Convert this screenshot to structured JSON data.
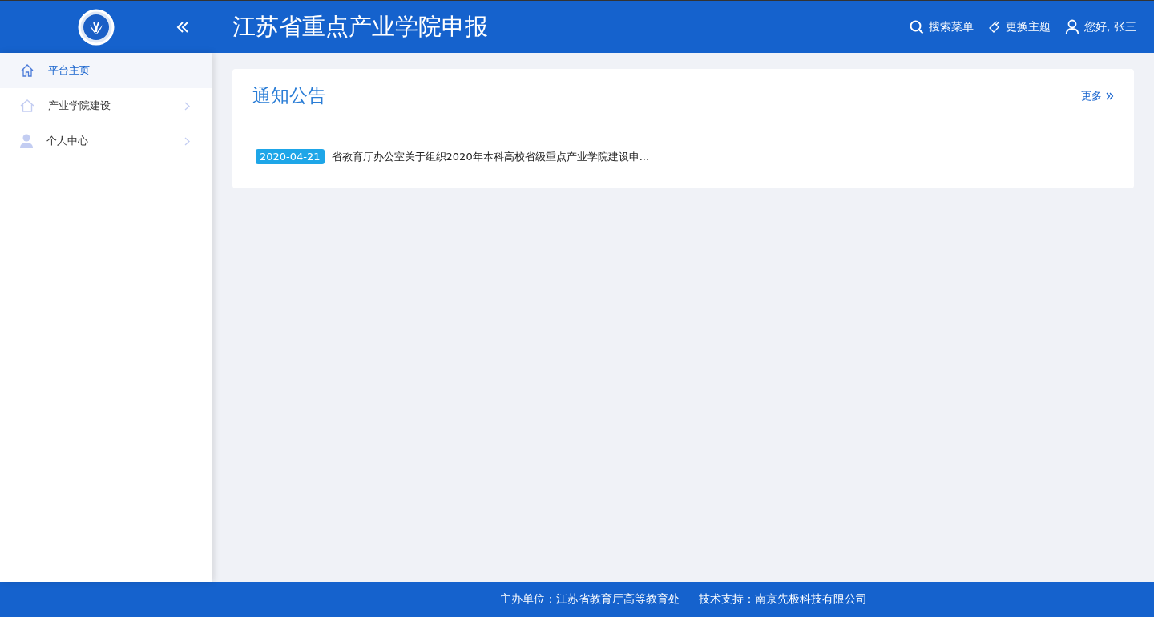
{
  "header": {
    "title": "江苏省重点产业学院申报",
    "actions": [
      {
        "kind": "search",
        "label": "搜索菜单"
      },
      {
        "kind": "theme",
        "label": "更换主题"
      },
      {
        "kind": "user",
        "label": "您好, 张三"
      }
    ]
  },
  "sidebar": {
    "items": [
      {
        "kind": "home",
        "label": "平台主页",
        "selected": true,
        "expandable": false
      },
      {
        "kind": "house",
        "label": "产业学院建设",
        "selected": false,
        "expandable": true
      },
      {
        "kind": "user",
        "label": "个人中心",
        "selected": false,
        "expandable": true
      }
    ]
  },
  "notice": {
    "title": "通知公告",
    "more": "更多",
    "items": [
      {
        "date": "2020-04-21",
        "text": "省教育厅办公室关于组织2020年本科高校省级重点产业学院建设申..."
      }
    ]
  },
  "footer": {
    "organizer": "主办单位：江苏省教育厅高等教育处",
    "support": "技术支持：南京先极科技有限公司"
  }
}
